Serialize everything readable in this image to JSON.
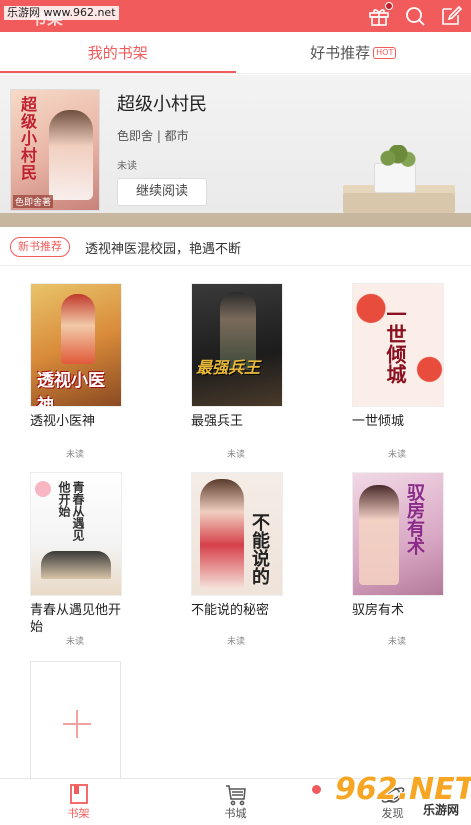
{
  "watermark_top": "乐游网 www.962.net",
  "header": {
    "title": "书架"
  },
  "tabs": [
    {
      "label": "我的书架"
    },
    {
      "label": "好书推荐",
      "badge": "HOT"
    }
  ],
  "current_book": {
    "title": "超级小村民",
    "cover_title": "超级小村民",
    "cover_author": "色即舍著",
    "meta": "色即舍 | 都市",
    "status": "未读",
    "continue_label": "继续阅读"
  },
  "recommend": {
    "badge": "新书推荐",
    "text": "透视神医混校园，艳遇不断"
  },
  "books": [
    {
      "title": "透视小医神",
      "cover_text": "透视小医神",
      "status": "未读"
    },
    {
      "title": "最强兵王",
      "cover_text": "最强兵王",
      "status": "未读"
    },
    {
      "title": "一世倾城",
      "cover_text": "一世倾城",
      "status": "未读"
    },
    {
      "title": "青春从遇见他开始",
      "cover_text": "青春从遇见他开始",
      "status": "未读"
    },
    {
      "title": "不能说的秘密",
      "cover_text": "不能说的",
      "status": "未读"
    },
    {
      "title": "驭房有术",
      "cover_text": "驭房有术",
      "status": "未读"
    }
  ],
  "bottom_nav": [
    {
      "label": "书架"
    },
    {
      "label": "书城"
    },
    {
      "label": "发现"
    }
  ],
  "watermark_bottom": {
    "main": "962.NET",
    "sub": "乐游网"
  },
  "colors": {
    "accent": "#f25b5b"
  }
}
